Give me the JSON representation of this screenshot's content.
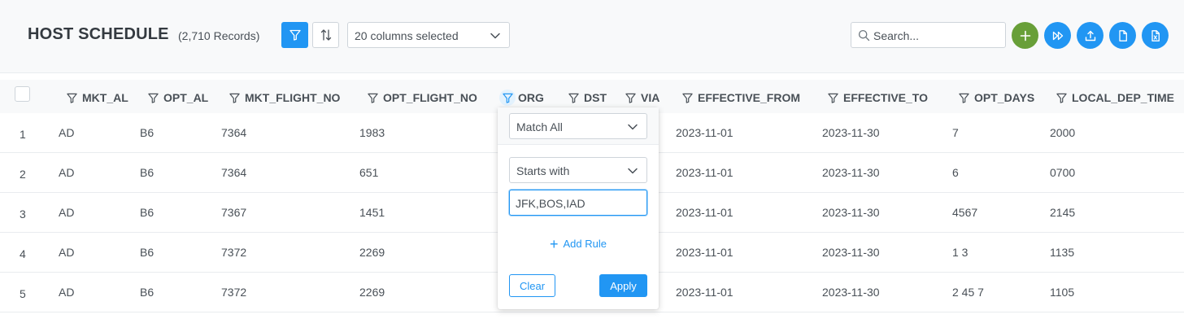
{
  "header": {
    "title": "HOST SCHEDULE",
    "record_count": "(2,710 Records)",
    "columns_selected": "20 columns selected",
    "search_placeholder": "Search..."
  },
  "colors": {
    "primary": "#2196f3",
    "success": "#689f38"
  },
  "table": {
    "columns": [
      "MKT_AL",
      "OPT_AL",
      "MKT_FLIGHT_NO",
      "OPT_FLIGHT_NO",
      "ORG",
      "DST",
      "VIA",
      "EFFECTIVE_FROM",
      "EFFECTIVE_TO",
      "OPT_DAYS",
      "LOCAL_DEP_TIME"
    ],
    "rows": [
      {
        "idx": "1",
        "mkt_al": "AD",
        "opt_al": "B6",
        "mkt_flight_no": "7364",
        "opt_flight_no": "1983",
        "effective_from": "2023-11-01",
        "effective_to": "2023-11-30",
        "opt_days": "7",
        "local_dep_time": "2000"
      },
      {
        "idx": "2",
        "mkt_al": "AD",
        "opt_al": "B6",
        "mkt_flight_no": "7364",
        "opt_flight_no": "651",
        "effective_from": "2023-11-01",
        "effective_to": "2023-11-30",
        "opt_days": "6",
        "local_dep_time": "0700"
      },
      {
        "idx": "3",
        "mkt_al": "AD",
        "opt_al": "B6",
        "mkt_flight_no": "7367",
        "opt_flight_no": "1451",
        "effective_from": "2023-11-01",
        "effective_to": "2023-11-30",
        "opt_days": "4567",
        "local_dep_time": "2145"
      },
      {
        "idx": "4",
        "mkt_al": "AD",
        "opt_al": "B6",
        "mkt_flight_no": "7372",
        "opt_flight_no": "2269",
        "effective_from": "2023-11-01",
        "effective_to": "2023-11-30",
        "opt_days": "1 3",
        "local_dep_time": "1135"
      },
      {
        "idx": "5",
        "mkt_al": "AD",
        "opt_al": "B6",
        "mkt_flight_no": "7372",
        "opt_flight_no": "2269",
        "effective_from": "2023-11-01",
        "effective_to": "2023-11-30",
        "opt_days": "2 45 7",
        "local_dep_time": "1105"
      }
    ]
  },
  "filter_popup": {
    "match_mode": "Match All",
    "constraint": "Starts with",
    "value": "JFK,BOS,IAD",
    "add_rule": "Add Rule",
    "clear": "Clear",
    "apply": "Apply"
  }
}
